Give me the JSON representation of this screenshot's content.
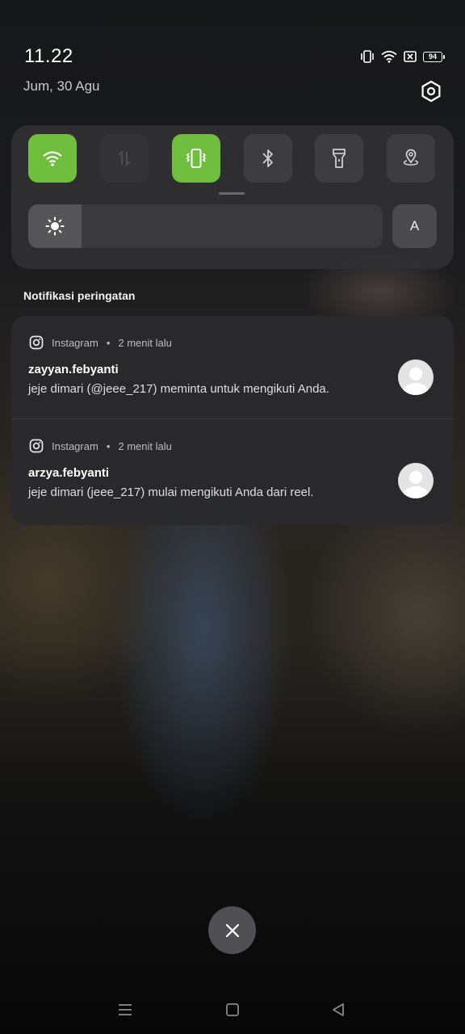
{
  "status_bar": {
    "time": "11.22",
    "date": "Jum, 30 Agu",
    "battery_level": "94",
    "icons": [
      "vibrate-icon",
      "wifi-icon",
      "no-sim-icon",
      "battery-icon"
    ]
  },
  "quick_settings": {
    "tiles": [
      {
        "name": "wifi",
        "icon": "wifi-icon",
        "active": true
      },
      {
        "name": "mobile-data",
        "icon": "data-arrows-icon",
        "active": false
      },
      {
        "name": "vibrate",
        "icon": "vibrate-icon",
        "active": true
      },
      {
        "name": "bluetooth",
        "icon": "bluetooth-icon",
        "active": false
      },
      {
        "name": "flashlight",
        "icon": "flashlight-icon",
        "active": false
      },
      {
        "name": "location",
        "icon": "location-icon",
        "active": false
      }
    ],
    "brightness_level": 0.15,
    "auto_brightness_label": "A"
  },
  "notifications": {
    "section_title": "Notifikasi peringatan",
    "items": [
      {
        "app": "Instagram",
        "time": "2 menit lalu",
        "sender": "zayyan.febyanti",
        "message": "jeje dimari (@jeee_217) meminta untuk mengikuti Anda."
      },
      {
        "app": "Instagram",
        "time": "2 menit lalu",
        "sender": "arzya.febyanti",
        "message": "jeje dimari (jeee_217) mulai mengikuti Anda dari reel."
      }
    ]
  },
  "colors": {
    "accent_active": "#6fbe3e",
    "tile_inactive": "#3d3d3f",
    "panel": "#303032"
  }
}
